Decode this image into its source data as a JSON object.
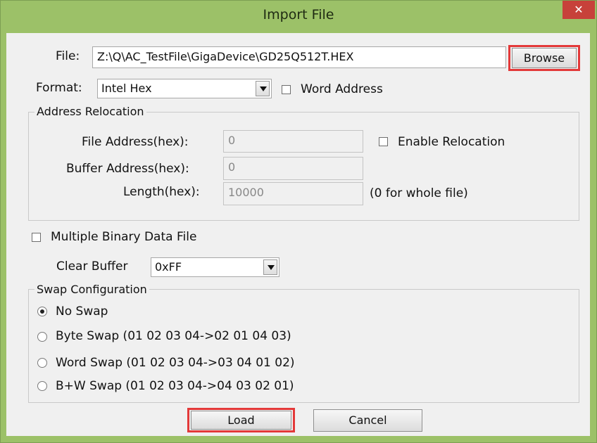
{
  "window": {
    "title": "Import File",
    "close_glyph": "✕"
  },
  "file": {
    "label": "File:",
    "value": "Z:\\Q\\AC_TestFile\\GigaDevice\\GD25Q512T.HEX",
    "browse_label": "Browse"
  },
  "format": {
    "label": "Format:",
    "selected": "Intel Hex",
    "word_address_label": "Word Address"
  },
  "relocation": {
    "legend": "Address Relocation",
    "file_address_label": "File Address(hex):",
    "file_address_value": "0",
    "buffer_address_label": "Buffer Address(hex):",
    "buffer_address_value": "0",
    "length_label": "Length(hex):",
    "length_value": "10000",
    "enable_label": "Enable Relocation",
    "length_hint": "(0 for whole file)"
  },
  "multiple_binary": {
    "label": "Multiple Binary Data File"
  },
  "clear_buffer": {
    "label": "Clear Buffer",
    "selected": "0xFF"
  },
  "swap": {
    "legend": "Swap Configuration",
    "options": [
      {
        "label": "No Swap",
        "checked": true
      },
      {
        "label": "Byte Swap (01 02 03 04->02 01 04 03)",
        "checked": false
      },
      {
        "label": "Word Swap (01 02 03 04->03 04 01 02)",
        "checked": false
      },
      {
        "label": "B+W Swap  (01 02 03 04->04 03 02 01)",
        "checked": false
      }
    ]
  },
  "buttons": {
    "load": "Load",
    "cancel": "Cancel"
  },
  "colors": {
    "frame": "#9cc168",
    "close": "#c7413a",
    "highlight": "#e33939"
  }
}
